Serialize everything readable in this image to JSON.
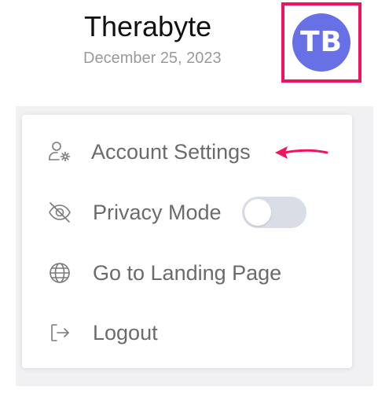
{
  "user": {
    "name": "Therabyte",
    "date": "December 25, 2023",
    "initials": "TB",
    "avatar_color": "#6870e6"
  },
  "menu": {
    "items": [
      {
        "label": "Account Settings",
        "icon": "user-gear-icon"
      },
      {
        "label": "Privacy Mode",
        "icon": "eye-slash-icon",
        "toggle_on": false
      },
      {
        "label": "Go to Landing Page",
        "icon": "globe-icon"
      },
      {
        "label": "Logout",
        "icon": "logout-icon"
      }
    ]
  },
  "annotation": {
    "highlight_color": "#f0145c"
  }
}
